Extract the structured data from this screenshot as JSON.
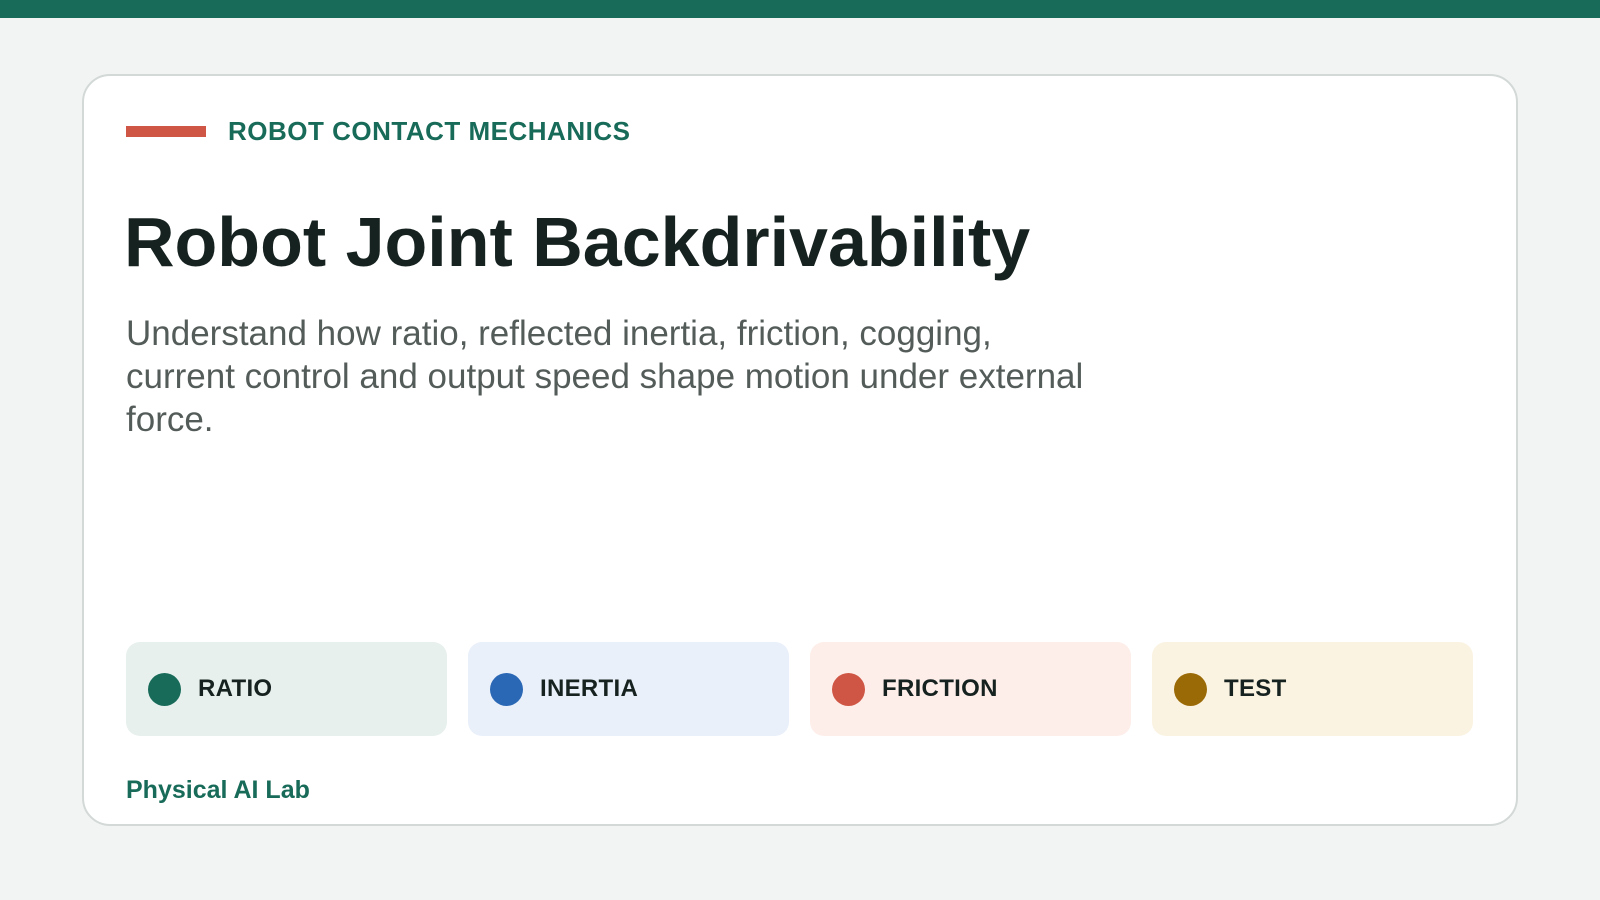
{
  "colors": {
    "top_bar": "#186b59",
    "accent": "#cf5644",
    "brand": "#186b59",
    "title": "#16221f",
    "subtitle": "#545c5a"
  },
  "header": {
    "eyebrow": "ROBOT CONTACT MECHANICS",
    "title": "Robot Joint Backdrivability",
    "subtitle": "Understand how ratio, reflected inertia, friction, cogging, current control and output speed shape motion under external force."
  },
  "chips": [
    {
      "label": "RATIO",
      "dot_color": "#186b59",
      "bg_color": "#e7f0ed"
    },
    {
      "label": "INERTIA",
      "dot_color": "#2a67b4",
      "bg_color": "#e9f0fa"
    },
    {
      "label": "FRICTION",
      "dot_color": "#cf5644",
      "bg_color": "#fdeeea"
    },
    {
      "label": "TEST",
      "dot_color": "#9a6a06",
      "bg_color": "#fbf3e2"
    }
  ],
  "footer": {
    "brand": "Physical AI Lab"
  }
}
